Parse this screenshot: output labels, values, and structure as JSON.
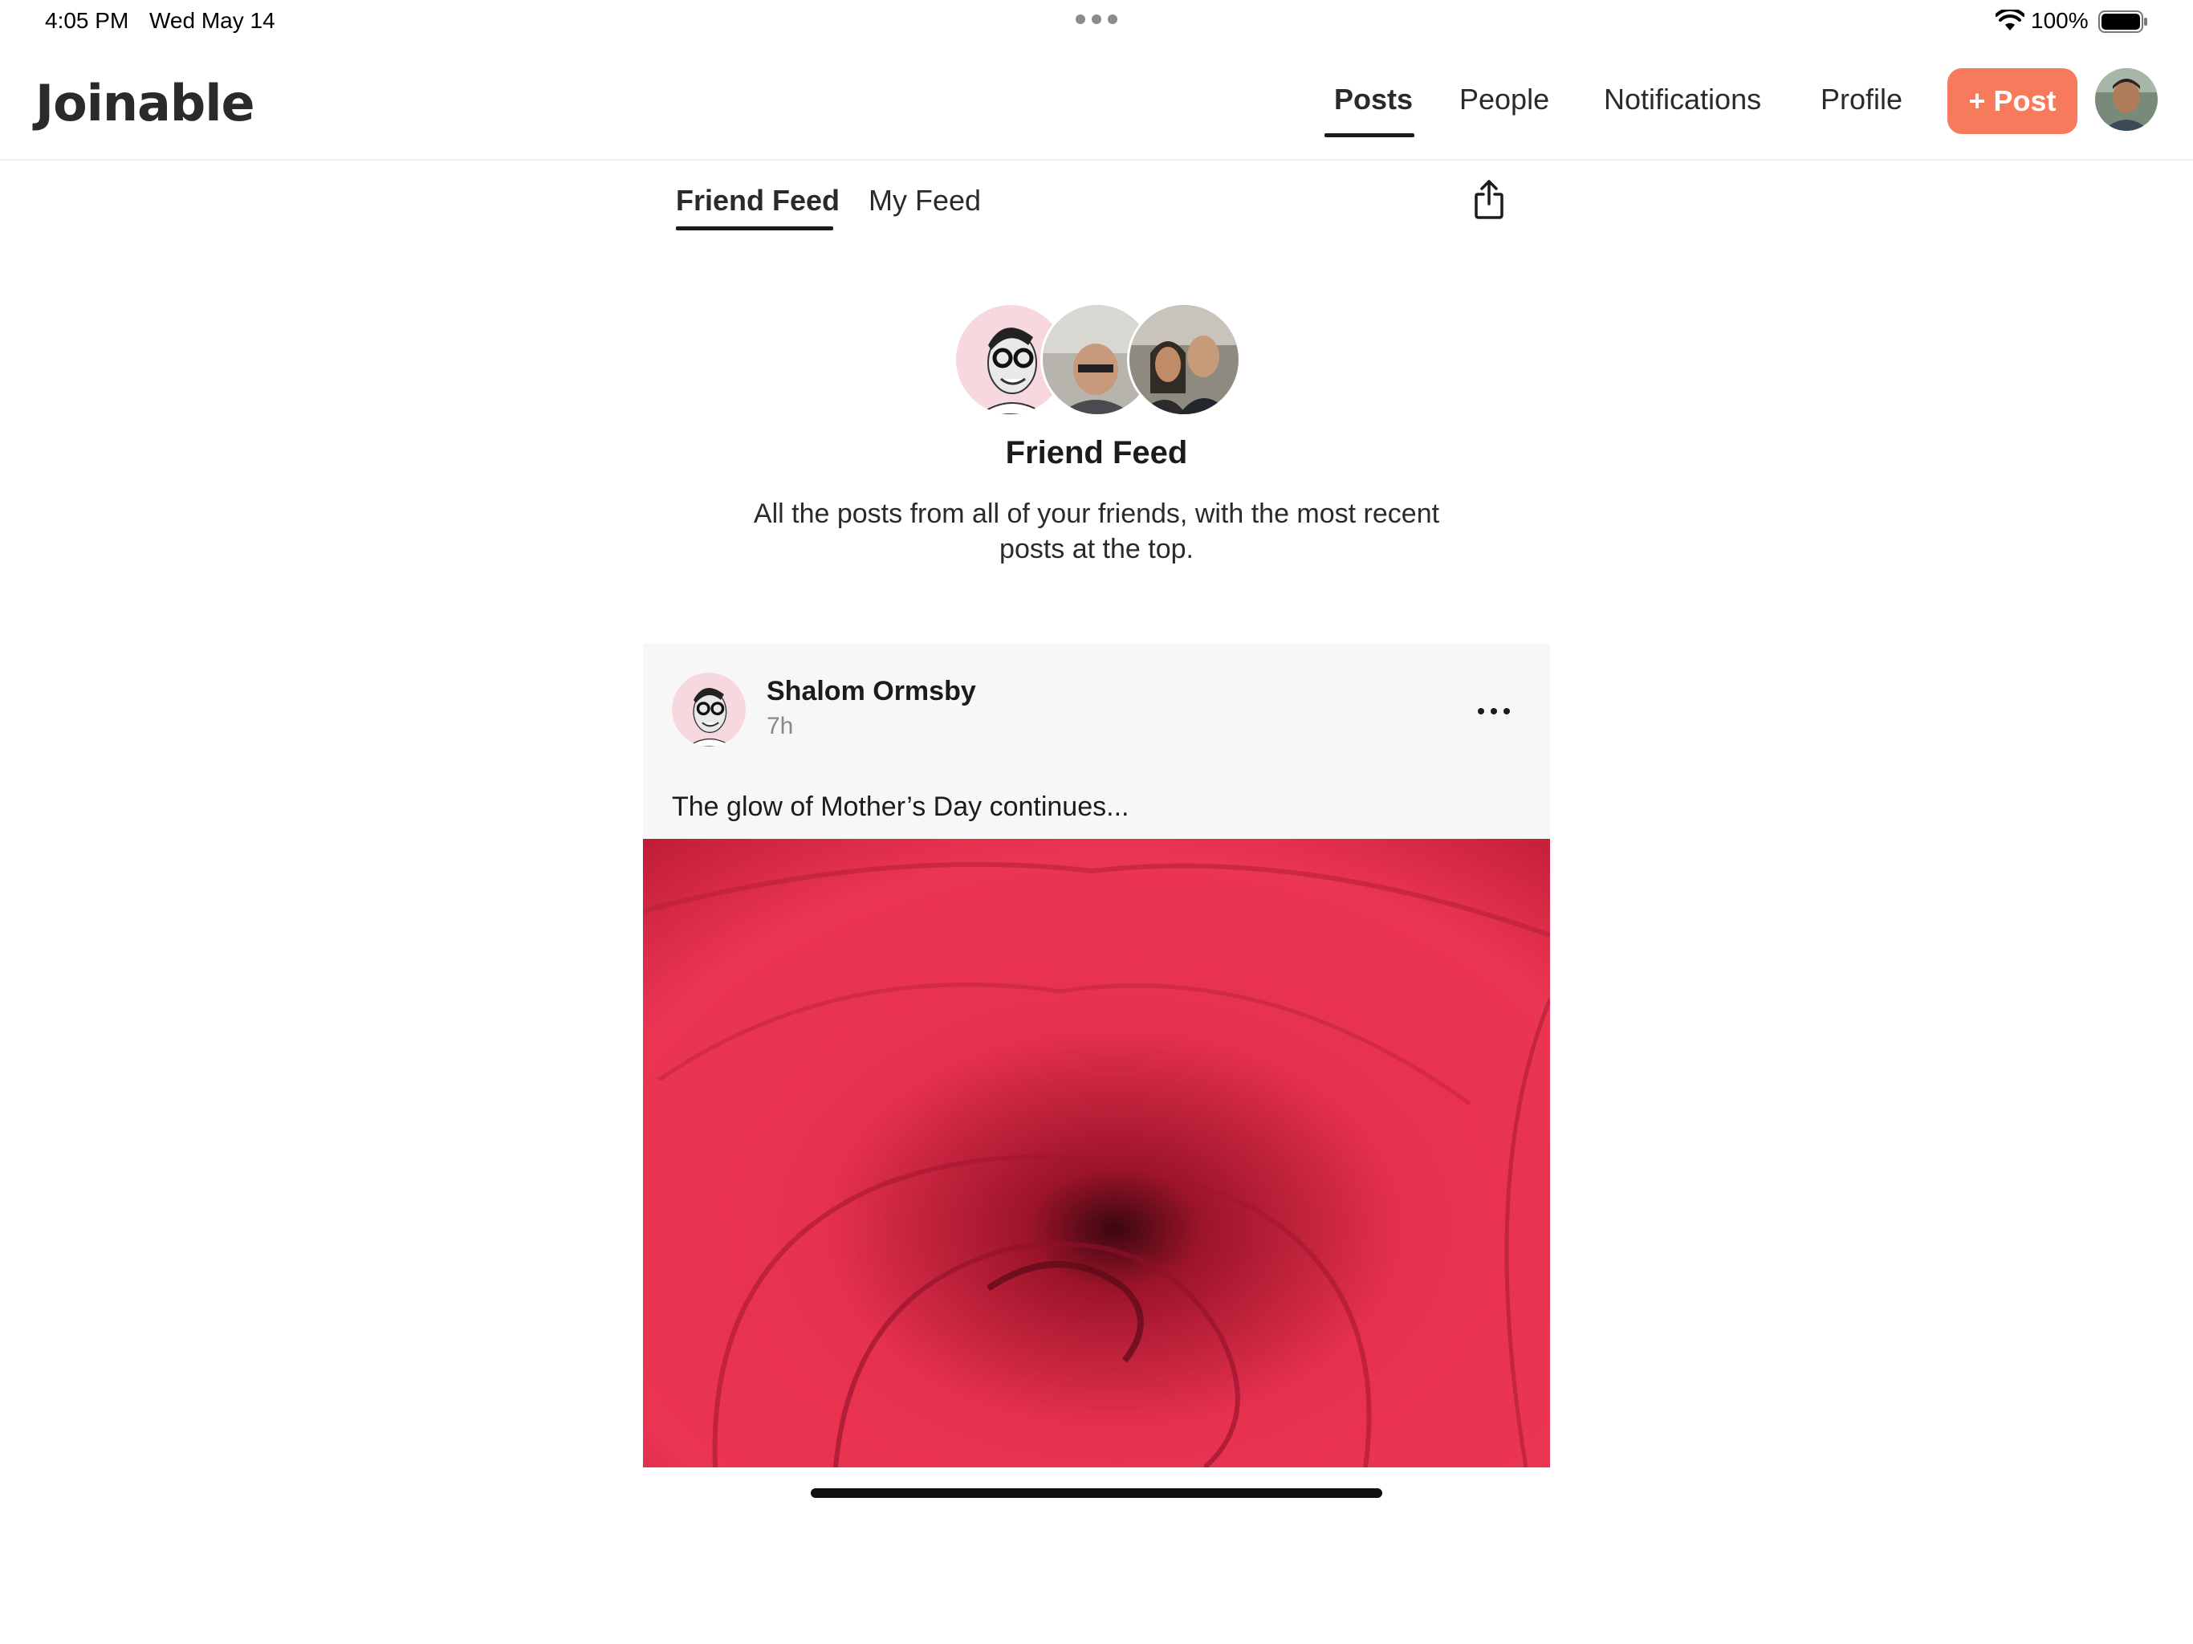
{
  "status_bar": {
    "time": "4:05 PM",
    "date": "Wed May 14",
    "battery_percent": "100%",
    "icons": [
      "wifi-icon",
      "battery-icon",
      "multitask-dots-icon"
    ]
  },
  "header": {
    "logo": "Joinable",
    "nav": [
      {
        "label": "Posts",
        "active": true
      },
      {
        "label": "People",
        "active": false
      },
      {
        "label": "Notifications",
        "active": false
      },
      {
        "label": "Profile",
        "active": false
      }
    ],
    "post_button_label": "+ Post",
    "accent_color": "#f87a5c"
  },
  "feed_tabs": {
    "items": [
      {
        "label": "Friend Feed",
        "active": true
      },
      {
        "label": "My Feed",
        "active": false
      }
    ],
    "share_icon": "share-icon"
  },
  "feed_header": {
    "title": "Friend Feed",
    "description": "All the posts from all of your friends, with the most recent posts at the top."
  },
  "post": {
    "author": "Shalom Ormsby",
    "time": "7h",
    "text": "The glow of Mother’s Day continues...",
    "more_icon": "more-horizontal-icon"
  }
}
